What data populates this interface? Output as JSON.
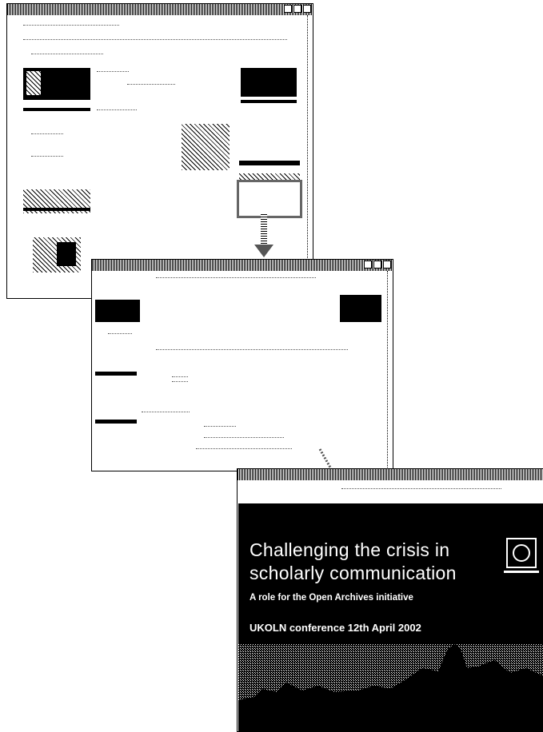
{
  "poster": {
    "title_line1": "Challenging the crisis in",
    "title_line2": "scholarly communication",
    "subtitle": "A role for the Open Archives initiative",
    "event_line": "UKOLN conference 12th April 2002"
  }
}
